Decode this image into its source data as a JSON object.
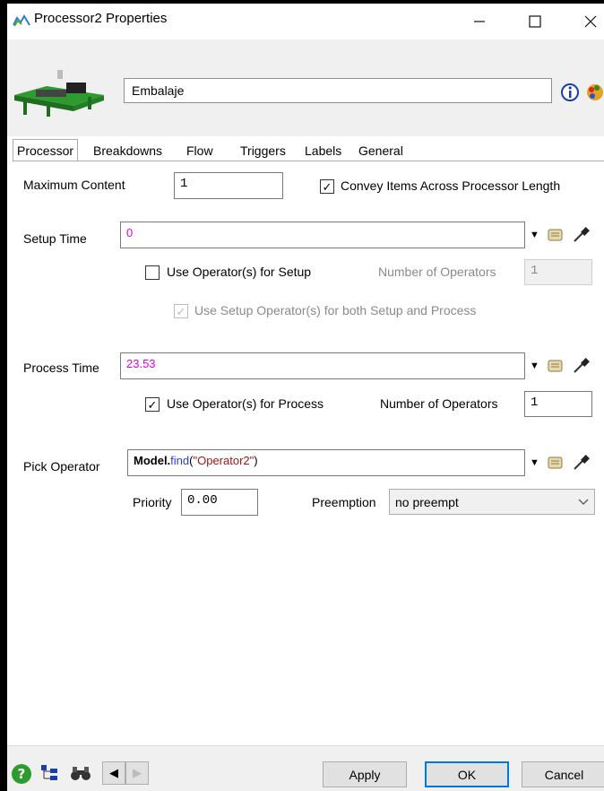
{
  "window": {
    "title": "Processor2  Properties",
    "minimize_icon": "minimize-icon",
    "maximize_icon": "maximize-icon",
    "close_icon": "close-icon"
  },
  "header": {
    "name_value": "Embalaje",
    "object_icon": "processor-object-icon",
    "info_icon": "info-icon",
    "color_icon": "color-palette-icon"
  },
  "tabs": [
    {
      "label": "Processor",
      "active": true
    },
    {
      "label": "Breakdowns"
    },
    {
      "label": "Flow"
    },
    {
      "label": "Triggers"
    },
    {
      "label": "Labels"
    },
    {
      "label": "General"
    }
  ],
  "processor": {
    "max_content_label": "Maximum Content",
    "max_content_value": "1",
    "convey_label": "Convey Items Across Processor Length",
    "convey_checked": true,
    "setup_time_label": "Setup Time",
    "setup_time_value": "0",
    "use_op_setup_label": "Use Operator(s) for Setup",
    "use_op_setup_checked": false,
    "num_ops_setup_label": "Number of Operators",
    "num_ops_setup_value": "1",
    "use_setup_both_label": "Use Setup Operator(s) for both Setup and Process",
    "use_setup_both_checked": true,
    "process_time_label": "Process Time",
    "process_time_value": "23.53",
    "use_op_process_label": "Use Operator(s) for Process",
    "use_op_process_checked": true,
    "num_ops_process_label": "Number of Operators",
    "num_ops_process_value": "1",
    "pick_operator_label": "Pick Operator",
    "pick_operator_code": {
      "bold": "Model.",
      "func": "find",
      "open": "(",
      "str": "\"Operator2\"",
      "close": ")"
    },
    "priority_label": "Priority",
    "priority_value": "0.00",
    "preemption_label": "Preemption",
    "preemption_value": "no preempt"
  },
  "footer": {
    "apply_label": "Apply",
    "ok_label": "OK",
    "cancel_label": "Cancel"
  }
}
